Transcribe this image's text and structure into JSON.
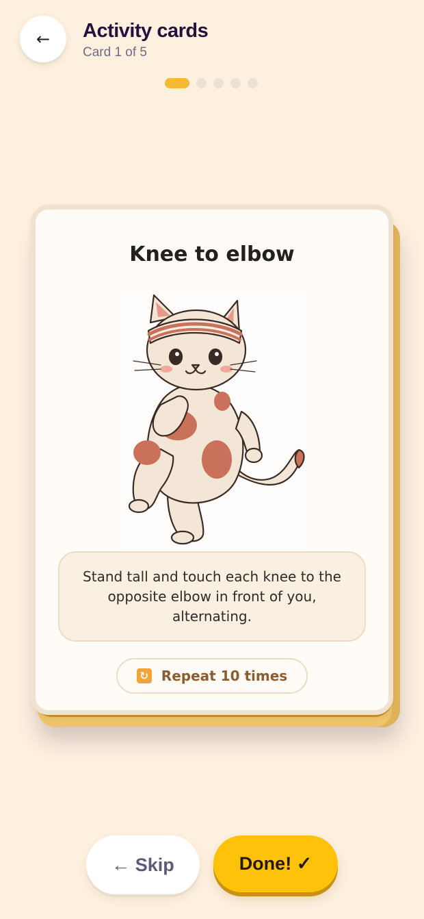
{
  "header": {
    "back_icon": "←",
    "title": "Activity cards",
    "subtitle": "Card 1 of 5"
  },
  "progress": {
    "current": 1,
    "total": 5
  },
  "card": {
    "title": "Knee to elbow",
    "illustration": "cat-doing-knee-to-elbow-illustration",
    "instruction": "Stand tall and touch each knee to the opposite elbow in front of you, alternating.",
    "repeat_icon": "🔁",
    "repeat_label": "Repeat 10 times"
  },
  "actions": {
    "skip_label": "← Skip",
    "done_label": "Done! ✓"
  },
  "colors": {
    "background": "#fdf0df",
    "accent_yellow": "#ffc20a",
    "active_dot": "#f6b934",
    "title_text": "#24123c"
  }
}
